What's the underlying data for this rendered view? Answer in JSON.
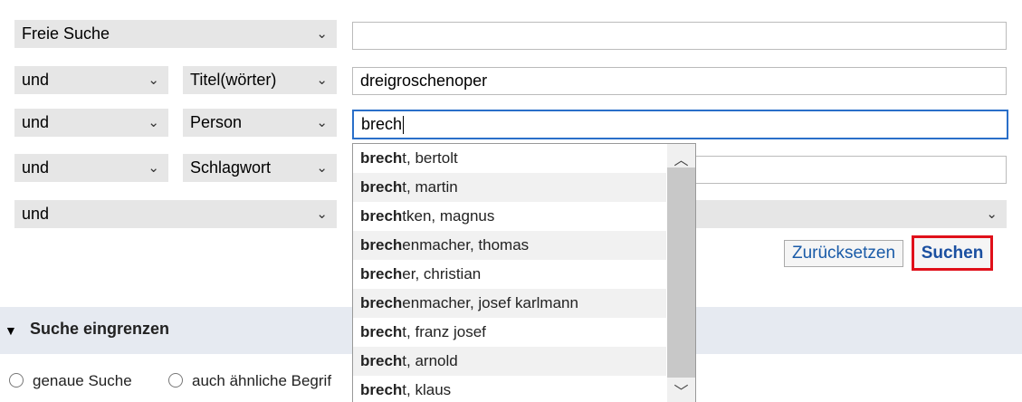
{
  "rows": [
    {
      "field": "Freie Suche",
      "value": ""
    },
    {
      "operator": "und",
      "field": "Titel(wörter)",
      "value": "dreigroschenoper"
    },
    {
      "operator": "und",
      "field": "Person",
      "value": "brech"
    },
    {
      "operator": "und",
      "field": "Schlagwort",
      "value": ""
    },
    {
      "operator": "und",
      "value": ""
    }
  ],
  "chevron": "⌄",
  "autocomplete": {
    "match": "brech",
    "items": [
      {
        "bold": "brech",
        "rest": "t, bertolt"
      },
      {
        "bold": "brech",
        "rest": "t, martin"
      },
      {
        "bold": "brech",
        "rest": "tken, magnus"
      },
      {
        "bold": "brech",
        "rest": "enmacher, thomas"
      },
      {
        "bold": "brech",
        "rest": "er, christian"
      },
      {
        "bold": "brech",
        "rest": "enmacher, josef karlmann"
      },
      {
        "bold": "brech",
        "rest": "t, franz josef"
      },
      {
        "bold": "brech",
        "rest": "t, arnold"
      },
      {
        "bold": "brech",
        "rest": "t, klaus"
      }
    ]
  },
  "buttons": {
    "reset": "Zurücksetzen",
    "search": "Suchen"
  },
  "section": {
    "title": "Suche eingrenzen"
  },
  "radios": [
    "genaue Suche",
    "auch ähnliche Begrif"
  ],
  "colors": {
    "highlight_border": "#e0101a",
    "focus_border": "#2a6fc9",
    "link_blue": "#1a5ba8"
  }
}
